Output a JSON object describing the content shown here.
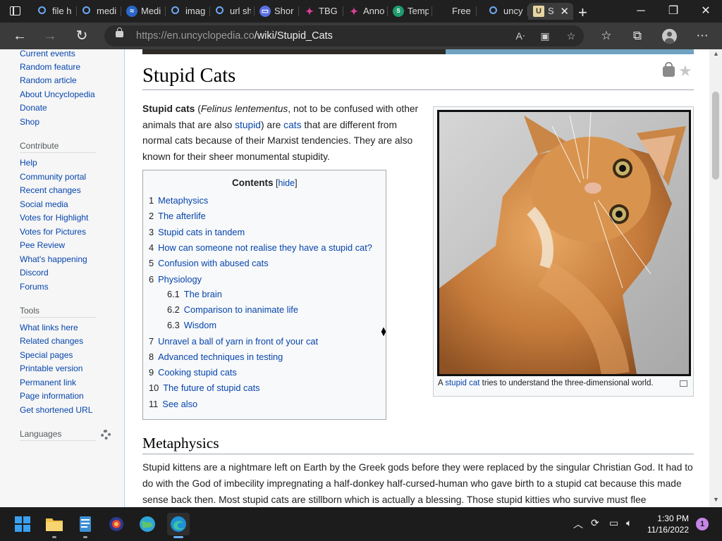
{
  "browser": {
    "tabs": [
      {
        "title": "file h",
        "icon": "search-icon"
      },
      {
        "title": "medi",
        "icon": "search-icon"
      },
      {
        "title": "Medi",
        "icon": "medium-icon"
      },
      {
        "title": "imag",
        "icon": "search-icon"
      },
      {
        "title": "url sh",
        "icon": "search-icon"
      },
      {
        "title": "Shor",
        "icon": "shortener-icon"
      },
      {
        "title": "TBG",
        "icon": "tbg-icon"
      },
      {
        "title": "Anno",
        "icon": "tbg-icon"
      },
      {
        "title": "Temp",
        "icon": "temp-icon"
      },
      {
        "title": "Free",
        "icon": "apple-icon"
      },
      {
        "title": "uncy",
        "icon": "search-icon"
      },
      {
        "title": "S",
        "icon": "uncyclopedia-icon"
      }
    ],
    "url_host": "https://en.uncyclopedia.co",
    "url_path": "/wiki/Stupid_Cats"
  },
  "sidebar": {
    "nav_links": [
      "Current events",
      "Random feature",
      "Random article",
      "About Uncyclopedia",
      "Donate",
      "Shop"
    ],
    "contribute_heading": "Contribute",
    "contribute_links": [
      "Help",
      "Community portal",
      "Recent changes",
      "Social media",
      "Votes for Highlight",
      "Votes for Pictures",
      "Pee Review",
      "What's happening",
      "Discord",
      "Forums"
    ],
    "tools_heading": "Tools",
    "tools_links": [
      "What links here",
      "Related changes",
      "Special pages",
      "Printable version",
      "Permanent link",
      "Page information",
      "Get shortened URL"
    ],
    "languages_heading": "Languages"
  },
  "article": {
    "title": "Stupid Cats",
    "intro": {
      "bold": "Stupid cats",
      "t1": " (",
      "latin": "Felinus lentementus",
      "t2": ", not to be confused with other animals that are also ",
      "link1": "stupid",
      "t3": ") are ",
      "link2": "cats",
      "t4": " that are different from normal cats because of their Marxist tendencies. They are also known for their sheer monumental stupidity."
    },
    "toc": {
      "title": "Contents",
      "hide_open": " [",
      "hide": "hide",
      "hide_close": "]",
      "items": [
        {
          "num": "1",
          "label": "Metaphysics"
        },
        {
          "num": "2",
          "label": "The afterlife"
        },
        {
          "num": "3",
          "label": "Stupid cats in tandem"
        },
        {
          "num": "4",
          "label": "How can someone not realise they have a stupid cat?"
        },
        {
          "num": "5",
          "label": "Confusion with abused cats"
        },
        {
          "num": "6",
          "label": "Physiology"
        },
        {
          "num": "6.1",
          "label": "The brain"
        },
        {
          "num": "6.2",
          "label": "Comparison to inanimate life"
        },
        {
          "num": "6.3",
          "label": "Wisdom"
        },
        {
          "num": "7",
          "label": "Unravel a ball of yarn in front of your cat"
        },
        {
          "num": "8",
          "label": "Advanced techniques in testing"
        },
        {
          "num": "9",
          "label": "Cooking stupid cats"
        },
        {
          "num": "10",
          "label": "The future of stupid cats"
        },
        {
          "num": "11",
          "label": "See also"
        }
      ]
    },
    "thumb_caption": {
      "c1": "A ",
      "link": "stupid cat",
      "c2": " tries to understand the three-dimensional world."
    },
    "section1_heading": "Metaphysics",
    "section1_text": "Stupid kittens are a nightmare left on Earth by the Greek gods before they were replaced by the singular Christian God. It had to do with the God of imbecility impregnating a half-donkey half-cursed-human who gave birth to a stupid cat because this made sense back then. Most stupid cats are stillborn which is actually a blessing. Those stupid kitties who survive must flee"
  },
  "taskbar": {
    "time": "1:30 PM",
    "date": "11/16/2022",
    "notification_count": "1"
  }
}
